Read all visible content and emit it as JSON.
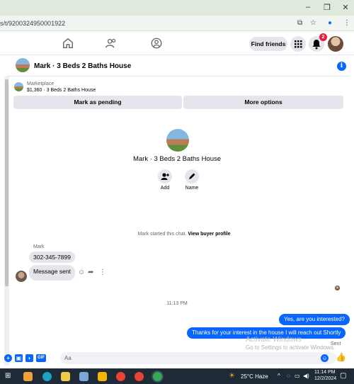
{
  "browser": {
    "url": "s/t/9200324950001922",
    "window_controls": [
      "–",
      "❐",
      "✕"
    ]
  },
  "topnav": {
    "find_friends": "Find friends",
    "notification_count": "2"
  },
  "chat": {
    "title": "Mark · 3 Beds 2 Baths House",
    "marketplace_label": "Marketplace",
    "listing": "$1,360 · 3 Beds 2 Baths House",
    "mark_pending": "Mark as pending",
    "more_options": "More options",
    "profile_name": "Mark · 3 Beds 2 Baths House",
    "add_label": "Add",
    "name_label": "Name",
    "started_text": "Mark started this chat.",
    "view_profile": "View buyer profile",
    "sender_name": "Mark",
    "msg_phone": "302-345-7899",
    "msg_sent": "Message sent",
    "timestamp": "11:13 PM",
    "out_msg1": "Yes, are you interested?",
    "out_msg2": "Thanks for your interest in the house I will reach out Shortly",
    "sent_status": "Sent",
    "composer_placeholder": "Aa"
  },
  "watermark": {
    "line1": "Activate Windows",
    "line2": "Go to Settings to activate Windows."
  },
  "taskbar": {
    "weather": "25°C  Haze",
    "time": "11:14 PM",
    "date": "12/2/2024"
  },
  "colors": {
    "accent": "#0866ff",
    "bubble_in": "#e4e6eb",
    "taskbar": "#1f2a37"
  }
}
